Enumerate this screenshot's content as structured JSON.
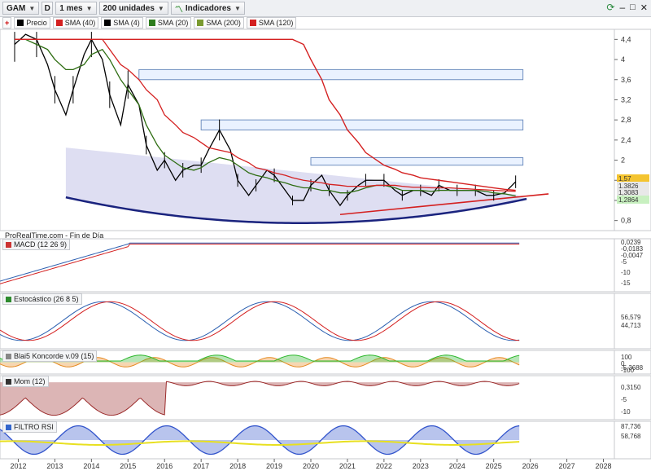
{
  "toolbar": {
    "symbol": "GAM",
    "type_button": "D",
    "period": "1 mes",
    "units": "200 unidades",
    "indicators": "Indicadores"
  },
  "legend": [
    {
      "name": "Precio",
      "color": "#000000"
    },
    {
      "name": "SMA (40)",
      "color": "#d42020"
    },
    {
      "name": "SMA (4)",
      "color": "#000000"
    },
    {
      "name": "SMA (20)",
      "color": "#2e7d1e"
    },
    {
      "name": "SMA (200)",
      "color": "#7a9a30"
    },
    {
      "name": "SMA (120)",
      "color": "#d42020"
    }
  ],
  "source_text": "ProRealTime.com - Fin de Día",
  "panel_labels": {
    "macd": "MACD (12 26 9)",
    "stoch": "Estocástico (26 8 5)",
    "koncorde": "Blai5 Koncorde v.09 (15)",
    "mom": "Mom (12)",
    "rsi": "FILTRO RSI"
  },
  "price_axis_ticks": [
    "4,4",
    "4",
    "3,6",
    "3,2",
    "2,8",
    "2,4",
    "2",
    "1,6",
    "1,2",
    "0,8"
  ],
  "price_value_labels": {
    "last": "1,57",
    "sma_a": "1,3826",
    "sma_b": "1,3083",
    "sma_c": "1,2864"
  },
  "macd_axis_ticks": [
    "-5",
    "-10",
    "-15"
  ],
  "macd_value_labels": {
    "a": "0,0239",
    "b": "-0,0183",
    "c": "-0,0047"
  },
  "stoch_value_labels": {
    "a": "56,579",
    "b": "44,713"
  },
  "koncorde_axis_ticks": [
    "100",
    "0",
    "-100"
  ],
  "koncorde_value_labels": {
    "a": "-5,3688"
  },
  "mom_axis_ticks": [
    "0,3150",
    "-5",
    "-10"
  ],
  "rsi_value_labels": {
    "a": "87,736",
    "b": "58,768"
  },
  "x_axis_years": [
    "2012",
    "2013",
    "2014",
    "2015",
    "2016",
    "2017",
    "2018",
    "2019",
    "2020",
    "2021",
    "2022",
    "2023",
    "2024",
    "2025",
    "2026",
    "2027",
    "2028"
  ],
  "chart_data": [
    {
      "type": "line",
      "panel": "price",
      "x": [
        2011.9,
        2012.2,
        2012.5,
        2012.8,
        2013.0,
        2013.3,
        2013.5,
        2013.8,
        2014.0,
        2014.3,
        2014.5,
        2014.8,
        2015.0,
        2015.3,
        2015.5,
        2015.8,
        2016.0,
        2016.3,
        2016.5,
        2016.8,
        2017.0,
        2017.2,
        2017.5,
        2017.8,
        2018.0,
        2018.3,
        2018.5,
        2018.8,
        2019.0,
        2019.3,
        2019.5,
        2019.8,
        2020.0,
        2020.3,
        2020.5,
        2020.8,
        2021.0,
        2021.3,
        2021.5,
        2021.8,
        2022.0,
        2022.3,
        2022.5,
        2022.8,
        2023.0,
        2023.3,
        2023.5,
        2023.8,
        2024.0,
        2024.3,
        2024.5,
        2024.8,
        2025.0,
        2025.3,
        2025.6
      ],
      "series": [
        {
          "name": "SMA (4)",
          "values": [
            4.3,
            4.5,
            4.4,
            3.9,
            3.4,
            2.9,
            3.4,
            4.1,
            4.4,
            4.0,
            3.3,
            2.7,
            3.5,
            3.1,
            2.3,
            1.8,
            2.0,
            1.6,
            1.8,
            1.9,
            1.9,
            2.2,
            2.6,
            2.2,
            1.6,
            1.3,
            1.5,
            1.8,
            1.7,
            1.4,
            1.2,
            1.2,
            1.5,
            1.7,
            1.4,
            1.1,
            1.3,
            1.5,
            1.6,
            1.6,
            1.6,
            1.4,
            1.3,
            1.4,
            1.4,
            1.3,
            1.5,
            1.4,
            1.4,
            1.4,
            1.4,
            1.3,
            1.3,
            1.35,
            1.57
          ]
        },
        {
          "name": "SMA (20)",
          "values": [
            4.4,
            4.4,
            4.3,
            4.2,
            4.0,
            3.8,
            3.8,
            3.9,
            4.1,
            4.2,
            4.0,
            3.6,
            3.4,
            3.1,
            2.7,
            2.3,
            2.1,
            1.95,
            1.85,
            1.8,
            1.85,
            1.95,
            2.05,
            2.0,
            1.9,
            1.75,
            1.7,
            1.65,
            1.6,
            1.55,
            1.5,
            1.45,
            1.45,
            1.4,
            1.4,
            1.35,
            1.35,
            1.4,
            1.45,
            1.5,
            1.5,
            1.45,
            1.4,
            1.4,
            1.4,
            1.38,
            1.4,
            1.4,
            1.4,
            1.4,
            1.4,
            1.38,
            1.35,
            1.33,
            1.29
          ]
        },
        {
          "name": "SMA (40)",
          "values": [
            4.4,
            4.4,
            4.4,
            4.4,
            4.4,
            4.4,
            4.4,
            4.4,
            4.4,
            4.4,
            4.2,
            3.9,
            3.8,
            3.6,
            3.4,
            3.2,
            2.9,
            2.7,
            2.55,
            2.45,
            2.35,
            2.25,
            2.2,
            2.15,
            2.05,
            1.95,
            1.85,
            1.8,
            1.75,
            1.7,
            1.65,
            1.6,
            1.58,
            1.55,
            1.52,
            1.5,
            1.48,
            1.48,
            1.48,
            1.5,
            1.5,
            1.5,
            1.48,
            1.46,
            1.46,
            1.45,
            1.45,
            1.45,
            1.44,
            1.43,
            1.42,
            1.41,
            1.4,
            1.39,
            1.38
          ]
        },
        {
          "name": "SMA (120)",
          "values": [
            4.4,
            4.4,
            4.4,
            4.4,
            4.4,
            4.4,
            4.4,
            4.4,
            4.4,
            4.4,
            4.4,
            4.4,
            4.4,
            4.4,
            4.4,
            4.4,
            4.4,
            4.4,
            4.4,
            4.4,
            4.4,
            4.4,
            4.4,
            4.4,
            4.4,
            4.4,
            4.4,
            4.4,
            4.4,
            4.4,
            4.4,
            4.3,
            4.0,
            3.6,
            3.2,
            2.9,
            2.6,
            2.35,
            2.15,
            2.0,
            1.9,
            1.82,
            1.75,
            1.7,
            1.65,
            1.62,
            1.6,
            1.57,
            1.55,
            1.52,
            1.5,
            1.47,
            1.45,
            1.42,
            1.4
          ]
        }
      ],
      "ylim": [
        0.6,
        4.6
      ],
      "xlim": [
        2011.5,
        2028.3
      ]
    },
    {
      "type": "line",
      "panel": "macd",
      "ylim": [
        -16,
        1
      ]
    },
    {
      "type": "line",
      "panel": "stoch",
      "ylim": [
        0,
        100
      ]
    },
    {
      "type": "area",
      "panel": "koncorde",
      "ylim": [
        -100,
        100
      ]
    },
    {
      "type": "area",
      "panel": "mom",
      "ylim": [
        -12,
        2
      ]
    },
    {
      "type": "area",
      "panel": "rsi",
      "ylim": [
        0,
        100
      ]
    }
  ]
}
